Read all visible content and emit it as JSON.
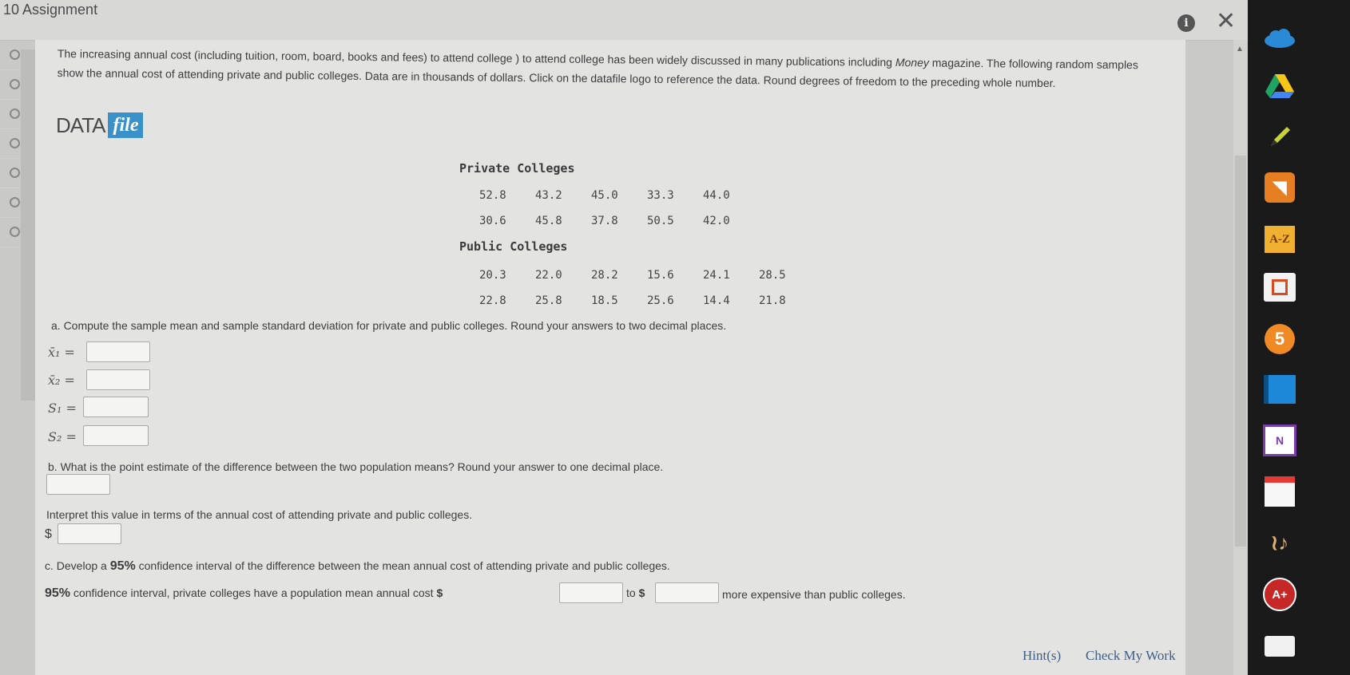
{
  "app": {
    "title": "10 Assignment"
  },
  "nav": {
    "count": 7
  },
  "question": {
    "intro": "The increasing annual cost (including tuition, room, board, books and fees) to attend college ) to attend college has been widely discussed in many publications including ",
    "intro_italic": "Money",
    "intro_line2": " magazine. The following random samples show the annual cost of attending private and public colleges. Data are in thousands of dollars. Click on the datafile logo to reference the data. Round degrees of freedom to the preceding whole number."
  },
  "datafile": {
    "data": "DATA",
    "file": "file"
  },
  "private_colleges": {
    "title": "Private Colleges",
    "rows": [
      [
        "52.8",
        "43.2",
        "45.0",
        "33.3",
        "44.0"
      ],
      [
        "30.6",
        "45.8",
        "37.8",
        "50.5",
        "42.0"
      ]
    ]
  },
  "public_colleges": {
    "title": "Public Colleges",
    "rows": [
      [
        "20.3",
        "22.0",
        "28.2",
        "15.6",
        "24.1",
        "28.5"
      ],
      [
        "22.8",
        "25.8",
        "18.5",
        "25.6",
        "14.4",
        "21.8"
      ]
    ]
  },
  "part_a": {
    "prompt": "a. Compute the sample mean and sample standard deviation for private and public colleges. Round your answers to two decimal places.",
    "labels": {
      "x1": "x̄₁ =",
      "x2": "x̄₂ =",
      "s1": "S₁ =",
      "s2": "S₂ ="
    },
    "values": {
      "x1": "",
      "x2": "",
      "s1": "",
      "s2": ""
    }
  },
  "part_b": {
    "prompt": "b. What is the point estimate of the difference between the two population means? Round your answer to one decimal place.",
    "interpret": "Interpret this value in terms of the annual cost of attending private and public colleges.",
    "dollar": "$"
  },
  "part_c": {
    "prompt_pre": "c. Develop a ",
    "pct": "95%",
    "prompt_post": " confidence interval of the difference between the mean annual cost of attending private and public colleges.",
    "line_pct": "95%",
    "line_pre": " confidence interval, private colleges have a population mean annual cost ",
    "dollar": "$",
    "to": "to",
    "line_post": "more expensive than public colleges."
  },
  "footer": {
    "hint": "Hint(s)",
    "check": "Check My Work"
  },
  "dock": {
    "az": "A-Z",
    "five": "5",
    "n": "N"
  }
}
